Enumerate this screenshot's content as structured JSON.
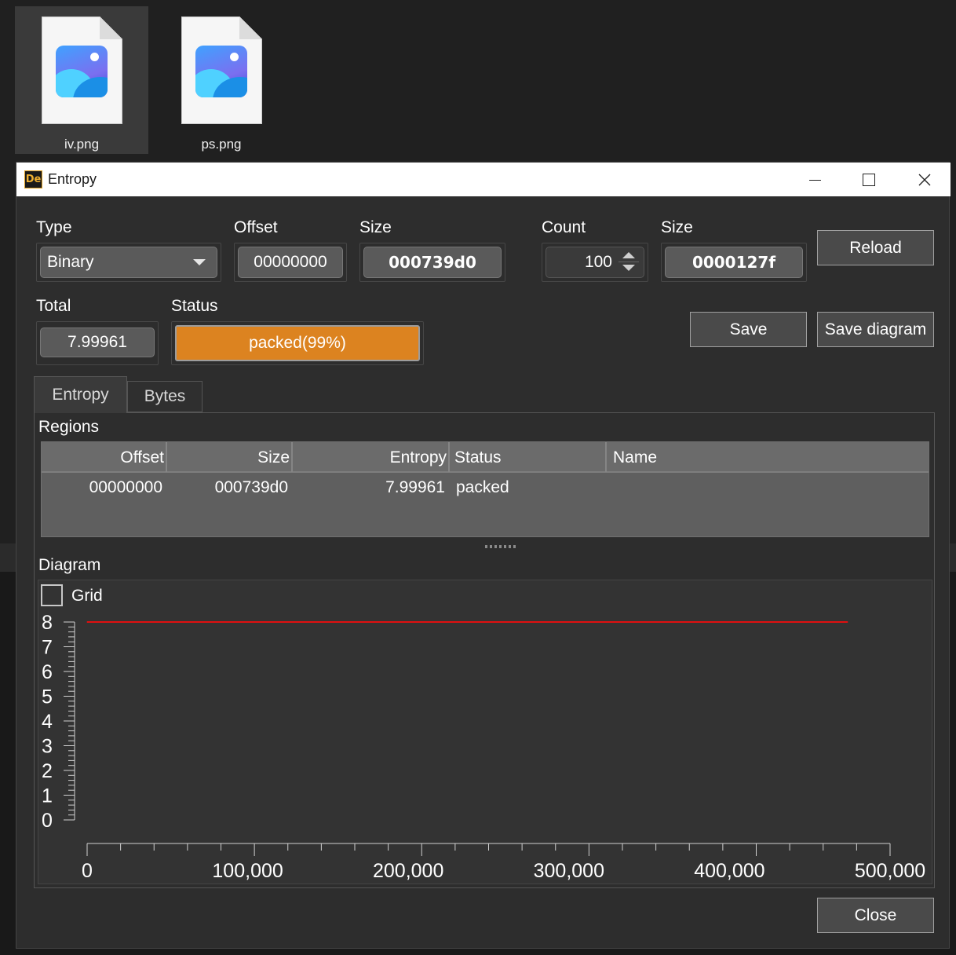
{
  "desktop": {
    "files": [
      {
        "name": "iv.png",
        "selected": true,
        "icon": "image-file-icon"
      },
      {
        "name": "ps.png",
        "selected": false,
        "icon": "image-file-icon"
      }
    ]
  },
  "window": {
    "title": "Entropy",
    "logo_text": "De",
    "controls": {
      "minimize": "minimize-icon",
      "maximize": "maximize-icon",
      "close": "close-icon"
    }
  },
  "form": {
    "type": {
      "label": "Type",
      "value": "Binary"
    },
    "offset": {
      "label": "Offset",
      "value": "00000000"
    },
    "size": {
      "label": "Size",
      "value": "000739d0"
    },
    "count": {
      "label": "Count",
      "value": "100"
    },
    "block_size": {
      "label": "Size",
      "value": "0000127f"
    },
    "total": {
      "label": "Total",
      "value": "7.99961"
    },
    "status": {
      "label": "Status",
      "value": "packed(99%)",
      "progress_percent": 99,
      "color": "#dc8320"
    }
  },
  "buttons": {
    "reload": "Reload",
    "save": "Save",
    "save_diagram": "Save diagram",
    "close": "Close"
  },
  "tabs": [
    {
      "label": "Entropy",
      "active": true
    },
    {
      "label": "Bytes",
      "active": false
    }
  ],
  "regions": {
    "title": "Regions",
    "columns": [
      "Offset",
      "Size",
      "Entropy",
      "Status",
      "Name"
    ],
    "rows": [
      [
        "00000000",
        "000739d0",
        "7.99961",
        "packed",
        ""
      ]
    ]
  },
  "diagram": {
    "title": "Diagram",
    "grid_label": "Grid",
    "grid_checked": false
  },
  "chart_data": {
    "type": "line",
    "title": "",
    "xlabel": "",
    "ylabel": "",
    "xlim": [
      0,
      500000
    ],
    "ylim": [
      0,
      8
    ],
    "grid": false,
    "x_ticks": [
      "0",
      "100,000",
      "200,000",
      "300,000",
      "400,000",
      "500,000"
    ],
    "y_ticks": [
      "0",
      "1",
      "2",
      "3",
      "4",
      "5",
      "6",
      "7",
      "8"
    ],
    "series": [
      {
        "color": "#e01010",
        "x": [
          0,
          65000,
          70000,
          75000,
          145000,
          150000,
          155000,
          473552
        ],
        "y": [
          7.999,
          7.999,
          8.0,
          7.999,
          7.999,
          8.0,
          7.999,
          7.999
        ]
      }
    ]
  }
}
